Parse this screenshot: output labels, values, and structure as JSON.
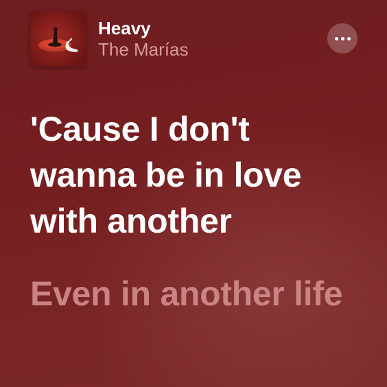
{
  "now_playing": {
    "title": "Heavy",
    "artist": "The Marías"
  },
  "more_button": {
    "icon": "ellipsis-icon"
  },
  "lyrics": {
    "current_line": "'Cause I don't wanna be in love with another",
    "next_line": "Even in another life"
  },
  "colors": {
    "background": "#761f21",
    "artist_text": "#d79b98",
    "upcoming_lyric": "#c98581",
    "active_lyric": "#ffffff"
  }
}
